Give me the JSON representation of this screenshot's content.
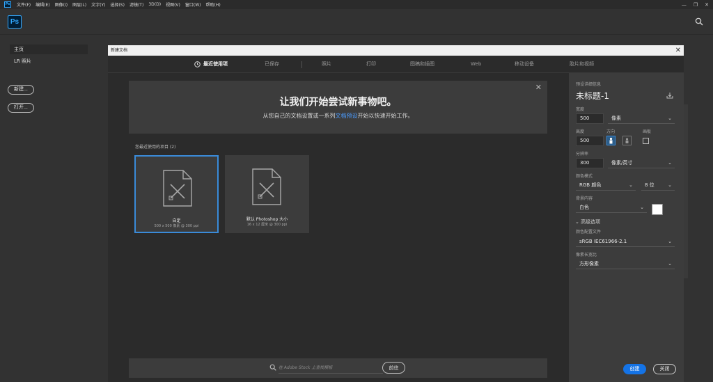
{
  "menubar": {
    "app_icon": "Ps",
    "items": [
      "文件(F)",
      "编辑(E)",
      "图像(I)",
      "图层(L)",
      "文字(Y)",
      "选择(S)",
      "滤镜(T)",
      "3D(D)",
      "视图(V)",
      "窗口(W)",
      "帮助(H)"
    ],
    "win_minimize": "—",
    "win_restore": "❐",
    "win_close": "✕"
  },
  "topbar": {
    "logo": "Ps",
    "search_icon": "search-icon"
  },
  "home": {
    "nav_home": "主页",
    "nav_lr": "LR 照片",
    "new_button": "新建...",
    "open_button": "打开..."
  },
  "dialog": {
    "title": "新建文档",
    "close": "✕",
    "tabs": [
      "最近使用项",
      "已保存",
      "照片",
      "打印",
      "图稿和插图",
      "Web",
      "移动设备",
      "胶片和视频"
    ],
    "active_tab": 0,
    "hero": {
      "title": "让我们开始尝试新事物吧。",
      "sub_before": "从您自己的文档设置或一系列",
      "sub_link": "文档预设",
      "sub_after": "开始以快速开始工作。",
      "close": "✕"
    },
    "recent_label": "您最近使用的项目  (2)",
    "cards": [
      {
        "name": "自定",
        "meta": "500 x 500 像素 @ 300 ppi",
        "selected": true
      },
      {
        "name": "默认 Photoshop 大小",
        "meta": "16 x 12 厘米 @ 300 ppi",
        "selected": false
      }
    ],
    "stock": {
      "placeholder": "在 Adobe Stock 上查找模板",
      "go_button": "前往"
    },
    "details": {
      "header": "预设详细信息",
      "doc_title": "未标题-1",
      "width_label": "宽度",
      "width_value": "500",
      "width_unit": "像素",
      "height_label": "高度",
      "height_value": "500",
      "orientation_label": "方向",
      "artboard_label": "画板",
      "resolution_label": "分辨率",
      "resolution_value": "300",
      "resolution_unit": "像素/英寸",
      "color_mode_label": "颜色模式",
      "color_mode_value": "RGB 颜色",
      "bit_depth_value": "8 位",
      "bg_label": "背景内容",
      "bg_value": "白色",
      "advanced_label": "高级选项",
      "profile_label": "颜色配置文件",
      "profile_value": "sRGB IEC61966-2.1",
      "pixel_ratio_label": "像素长宽比",
      "pixel_ratio_value": "方形像素",
      "create_button": "创建",
      "close_button": "关闭"
    }
  },
  "colors": {
    "accent": "#1473e6",
    "selection": "#3a8bd9",
    "link": "#4b9cff"
  }
}
